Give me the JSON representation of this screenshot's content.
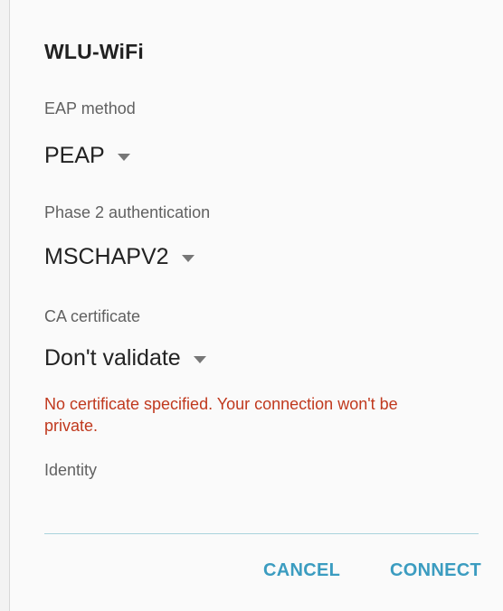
{
  "dialog": {
    "title": "WLU-WiFi"
  },
  "fields": {
    "eap_method": {
      "label": "EAP method",
      "value": "PEAP"
    },
    "phase2": {
      "label": "Phase 2 authentication",
      "value": "MSCHAPV2"
    },
    "ca_certificate": {
      "label": "CA certificate",
      "value": "Don't validate"
    },
    "warning": "No certificate specified. Your connection won't be private.",
    "identity": {
      "label": "Identity",
      "value": ""
    }
  },
  "actions": {
    "cancel_label": "CANCEL",
    "connect_label": "CONNECT"
  },
  "colors": {
    "accent": "#3b9cc0",
    "warning": "#c0391e",
    "underline": "#a9d3dc"
  }
}
